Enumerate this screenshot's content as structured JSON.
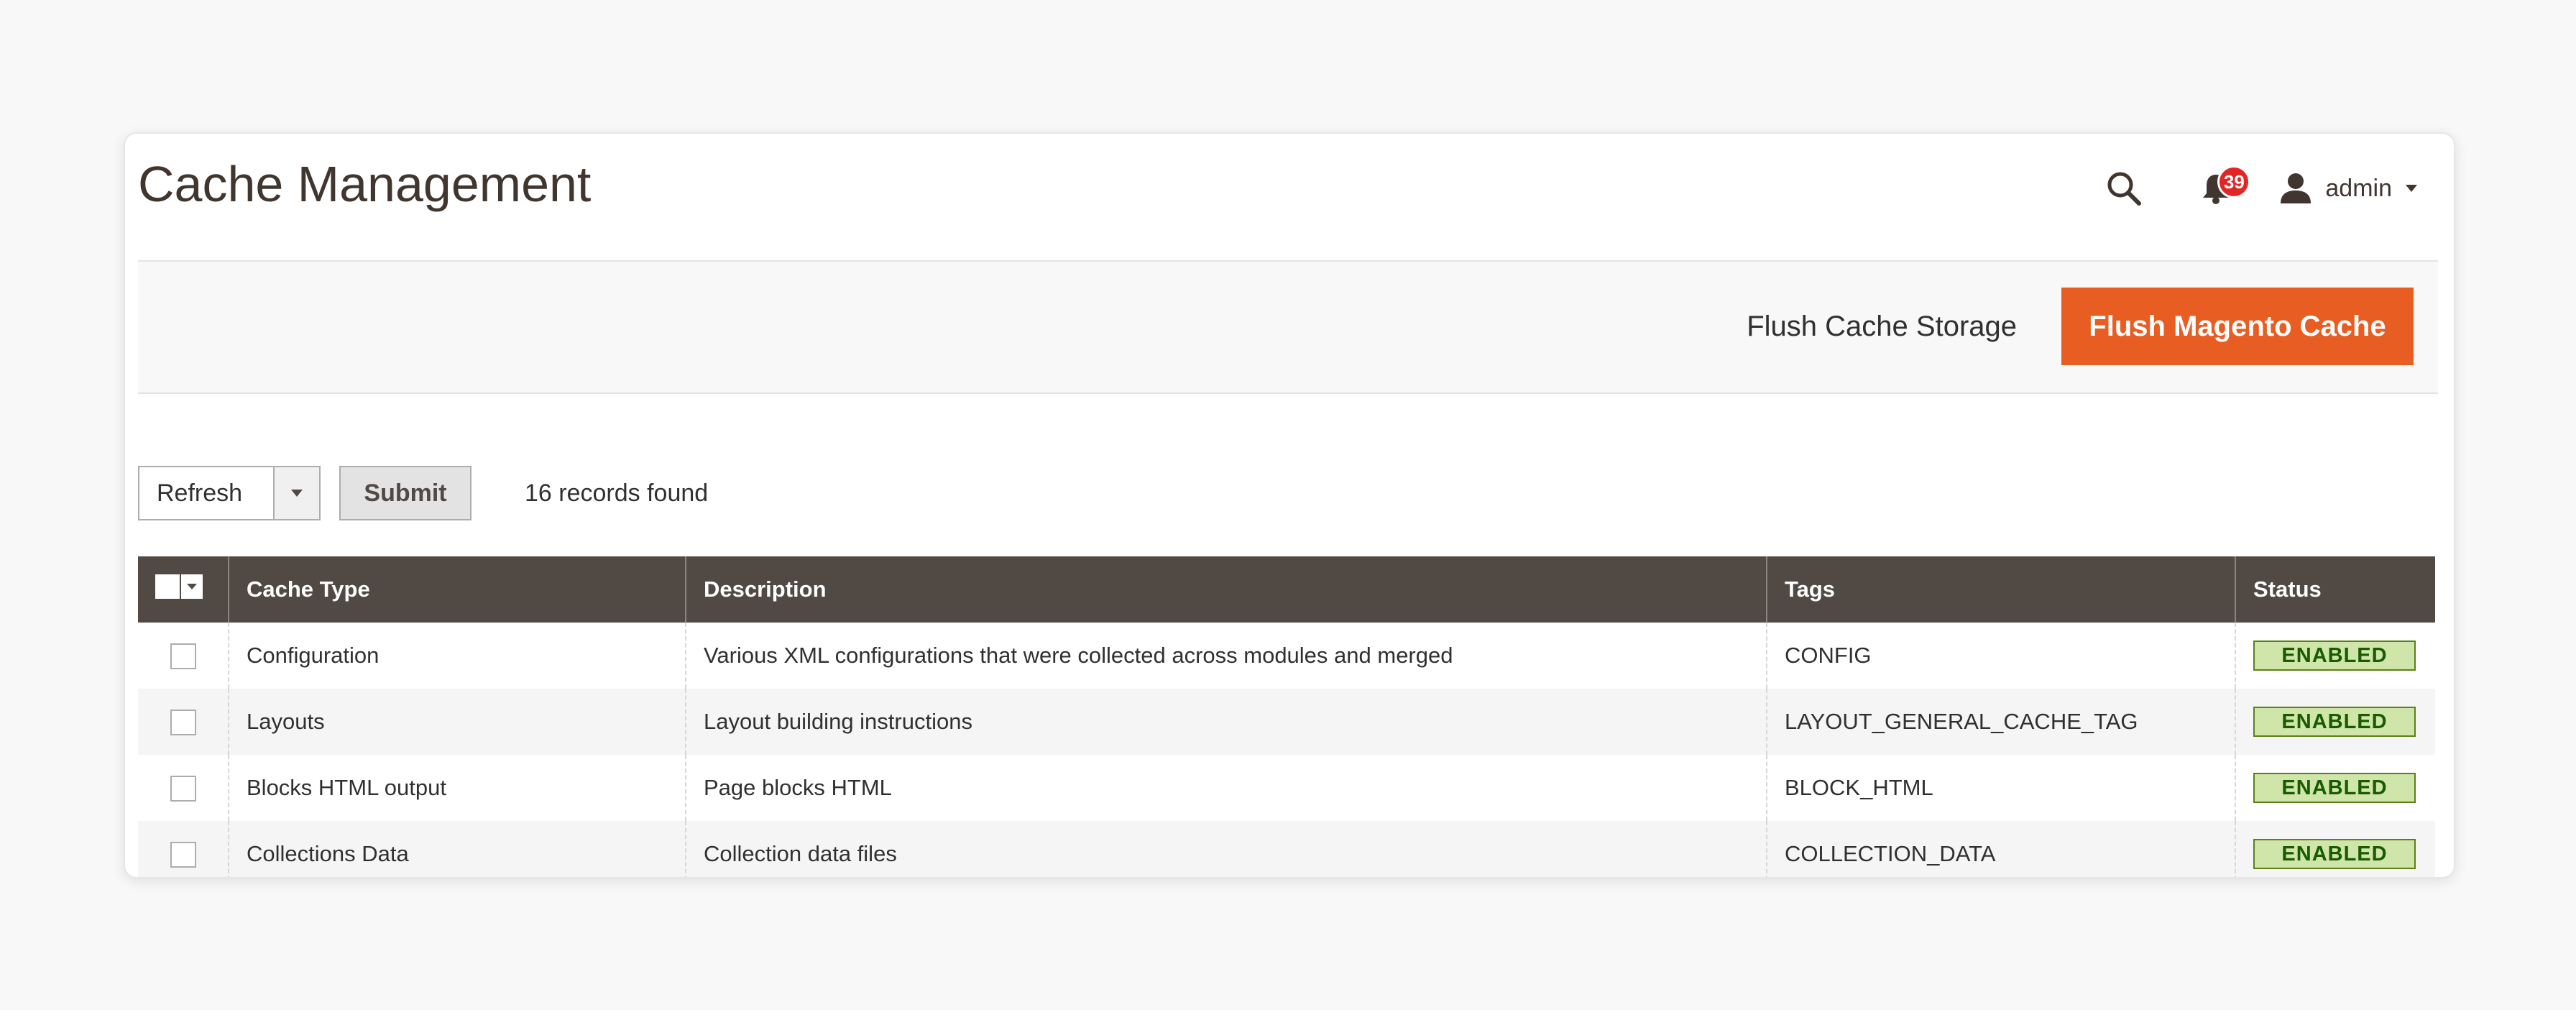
{
  "page": {
    "title": "Cache Management"
  },
  "header": {
    "search_icon": "search-icon",
    "notification_count": "39",
    "user_name": "admin"
  },
  "actions": {
    "flush_storage_label": "Flush Cache Storage",
    "flush_magento_label": "Flush Magento Cache"
  },
  "grid_actions": {
    "mass_action_value": "Refresh",
    "submit_label": "Submit",
    "records_found": "16 records found"
  },
  "table": {
    "columns": [
      "Cache Type",
      "Description",
      "Tags",
      "Status"
    ],
    "rows": [
      {
        "cache_type": "Configuration",
        "description": "Various XML configurations that were collected across modules and merged",
        "tags": "CONFIG",
        "status": "ENABLED"
      },
      {
        "cache_type": "Layouts",
        "description": "Layout building instructions",
        "tags": "LAYOUT_GENERAL_CACHE_TAG",
        "status": "ENABLED"
      },
      {
        "cache_type": "Blocks HTML output",
        "description": "Page blocks HTML",
        "tags": "BLOCK_HTML",
        "status": "ENABLED"
      },
      {
        "cache_type": "Collections Data",
        "description": "Collection data files",
        "tags": "COLLECTION_DATA",
        "status": "ENABLED"
      }
    ]
  },
  "colors": {
    "accent": "#e85d22",
    "table_header": "#514943",
    "status_bg": "#d0e5a9",
    "status_text": "#185b00",
    "badge": "#e22626"
  }
}
